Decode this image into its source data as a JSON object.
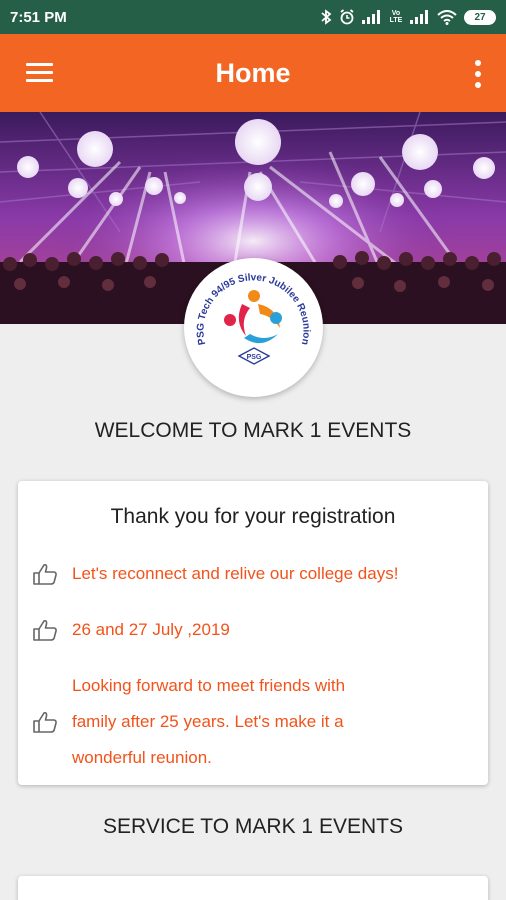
{
  "status_bar": {
    "time": "7:51 PM",
    "battery": "27",
    "network_label": "Vo LTE"
  },
  "app_bar": {
    "title": "Home",
    "menu_icon": "hamburger-menu-icon",
    "overflow_icon": "more-vert-icon"
  },
  "logo": {
    "text_arc": "PSG Tech 94/95 Silver Jubilee Reunion",
    "badge": "PSG"
  },
  "welcome": {
    "heading": "WELCOME TO MARK 1 EVENTS"
  },
  "registration_card": {
    "title": "Thank you for your registration",
    "items": [
      {
        "icon": "thumbs-up-icon",
        "text": "Let's reconnect and relive our college days!"
      },
      {
        "icon": "thumbs-up-icon",
        "text": "26 and 27 July ,2019"
      },
      {
        "icon": "thumbs-up-icon",
        "lines": [
          "Looking forward to meet friends with",
          "family after 25 years. Let's make it a",
          "wonderful reunion."
        ]
      }
    ]
  },
  "service": {
    "heading": "SERVICE TO MARK 1 EVENTS"
  },
  "colors": {
    "status_bar": "#255f48",
    "app_bar": "#f26522",
    "accent_text": "#f2531b",
    "background": "#eeeeee"
  }
}
